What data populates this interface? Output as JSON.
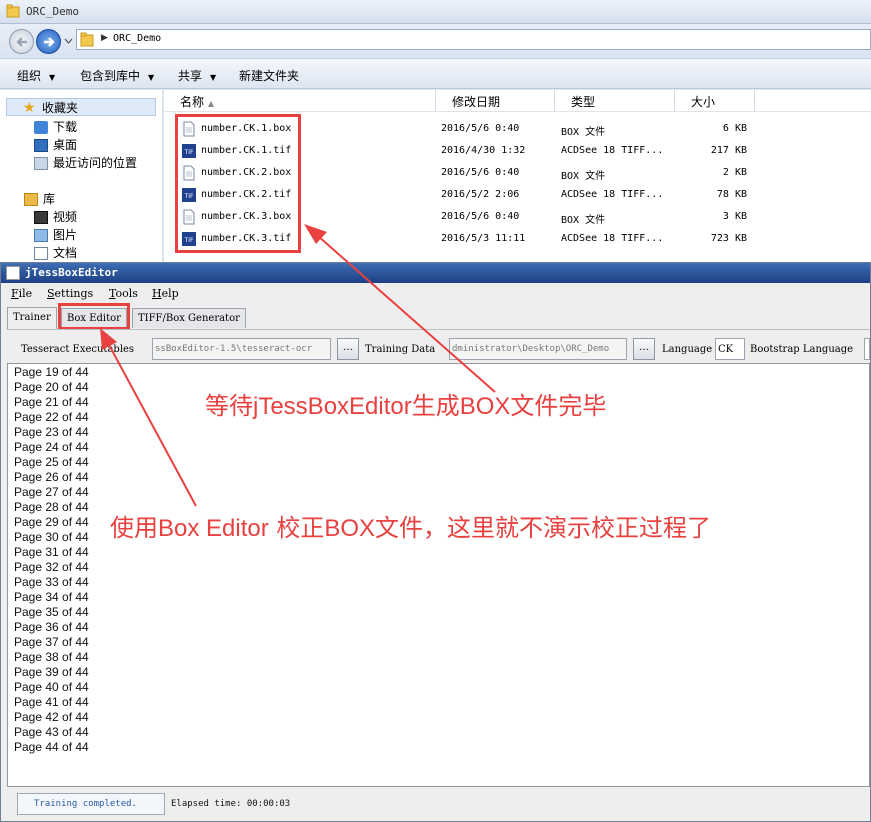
{
  "explorer": {
    "window_title": "ORC_Demo",
    "address": "ORC_Demo",
    "commands": [
      "组织",
      "包含到库中",
      "共享",
      "新建文件夹"
    ],
    "tree": {
      "favorites": "收藏夹",
      "favorites_items": [
        "下载",
        "桌面",
        "最近访问的位置"
      ],
      "libraries": "库",
      "library_items": [
        "视频",
        "图片",
        "文档"
      ]
    },
    "columns": [
      "名称",
      "修改日期",
      "类型",
      "大小"
    ],
    "files": [
      {
        "name": "number.CK.1.box",
        "date": "2016/5/6 0:40",
        "type": "BOX 文件",
        "size": "6 KB",
        "icon": "box-file-icon"
      },
      {
        "name": "number.CK.1.tif",
        "date": "2016/4/30 1:32",
        "type": "ACDSee 18 TIFF...",
        "size": "217 KB",
        "icon": "tif-file-icon"
      },
      {
        "name": "number.CK.2.box",
        "date": "2016/5/6 0:40",
        "type": "BOX 文件",
        "size": "2 KB",
        "icon": "box-file-icon"
      },
      {
        "name": "number.CK.2.tif",
        "date": "2016/5/2 2:06",
        "type": "ACDSee 18 TIFF...",
        "size": "78 KB",
        "icon": "tif-file-icon"
      },
      {
        "name": "number.CK.3.box",
        "date": "2016/5/6 0:40",
        "type": "BOX 文件",
        "size": "3 KB",
        "icon": "box-file-icon"
      },
      {
        "name": "number.CK.3.tif",
        "date": "2016/5/3 11:11",
        "type": "ACDSee 18 TIFF...",
        "size": "723 KB",
        "icon": "tif-file-icon"
      }
    ]
  },
  "jtess": {
    "window_title": "jTessBoxEditor",
    "menu": [
      "File",
      "Settings",
      "Tools",
      "Help"
    ],
    "tabs": [
      "Trainer",
      "Box Editor",
      "TIFF/Box Generator"
    ],
    "toolbar": {
      "tesseract_label": "Tesseract Executables",
      "tesseract_value": "ssBoxEditor-1.5\\tesseract-ocr",
      "browse_label": "...",
      "training_label": "Training Data",
      "training_value": "dministrator\\Desktop\\ORC_Demo",
      "language_label": "Language",
      "language_value": "CK",
      "bootstrap_label": "Bootstrap Language"
    },
    "log_lines": [
      "Page 19 of 44",
      "Page 20 of 44",
      "Page 21 of 44",
      "Page 22 of 44",
      "Page 23 of 44",
      "Page 24 of 44",
      "Page 25 of 44",
      "Page 26 of 44",
      "Page 27 of 44",
      "Page 28 of 44",
      "Page 29 of 44",
      "Page 30 of 44",
      "Page 31 of 44",
      "Page 32 of 44",
      "Page 33 of 44",
      "Page 34 of 44",
      "Page 35 of 44",
      "Page 36 of 44",
      "Page 37 of 44",
      "Page 38 of 44",
      "Page 39 of 44",
      "Page 40 of 44",
      "Page 41 of 44",
      "Page 42 of 44",
      "Page 43 of 44",
      "Page 44 of 44"
    ],
    "status": "Training completed.",
    "elapsed": "Elapsed time: 00:00:03"
  },
  "annotations": {
    "wait_prefix": "等待",
    "wait_brand": "jTessBoxEditor",
    "wait_middle": "生成",
    "wait_box": "BOX",
    "wait_suffix": "文件完毕",
    "use_prefix": "使用",
    "use_brand": "Box Editor",
    "use_middle": " 校正",
    "use_box": "BOX",
    "use_suffix": "文件，这里就不演示校正过程了"
  },
  "colors": {
    "annotation": "#e8413f",
    "title_bar": "#1d3f84",
    "status_text": "#2a5aa5"
  }
}
